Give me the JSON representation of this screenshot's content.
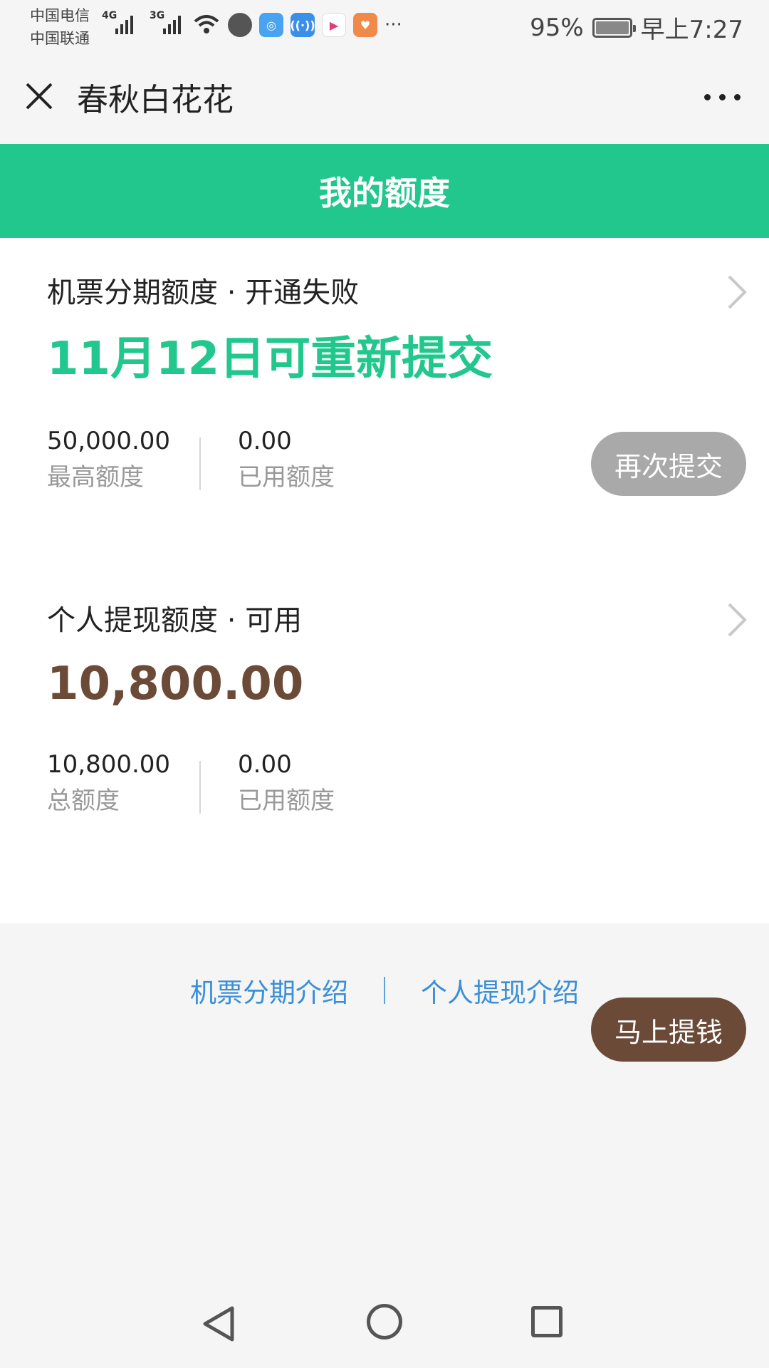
{
  "status_bar": {
    "carrier_1": "中国电信",
    "carrier_2": "中国联通",
    "network_1": "4G",
    "network_2": "3G",
    "battery_percent": "95%",
    "time": "早上7:27",
    "overflow": "···"
  },
  "nav": {
    "title": "春秋白花花"
  },
  "header": {
    "title": "我的额度"
  },
  "cards": [
    {
      "title": "机票分期额度 · 开通失败",
      "headline": "11月12日可重新提交",
      "stats": [
        {
          "value": "50,000.00",
          "label": "最高额度"
        },
        {
          "value": "0.00",
          "label": "已用额度"
        }
      ],
      "button": "再次提交"
    },
    {
      "title": "个人提现额度 · 可用",
      "headline": "10,800.00",
      "stats": [
        {
          "value": "10,800.00",
          "label": "总额度"
        },
        {
          "value": "0.00",
          "label": "已用额度"
        }
      ],
      "button": "马上提钱"
    }
  ],
  "footer": {
    "link_1": "机票分期介绍",
    "link_2": "个人提现介绍"
  },
  "colors": {
    "accent_green": "#22c78e",
    "brown": "#6b4a38",
    "link_blue": "#3b8fd6"
  }
}
